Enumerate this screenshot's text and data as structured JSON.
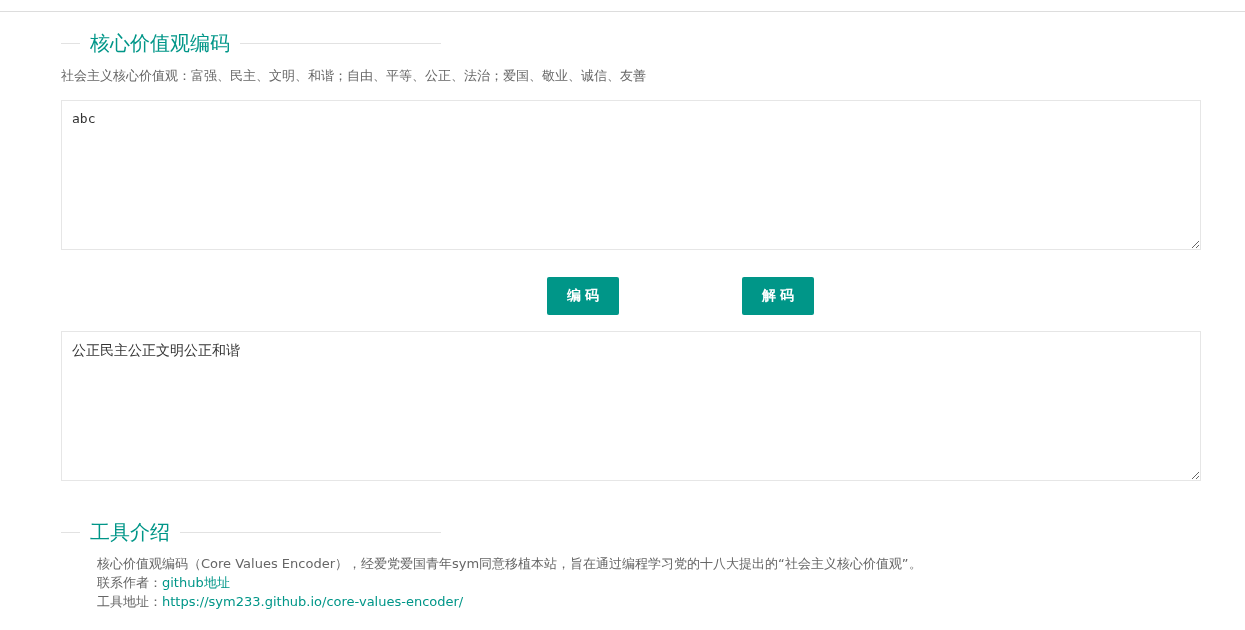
{
  "encoder": {
    "title": "核心价值观编码",
    "subtitle": "社会主义核心价值观：富强、民主、文明、和谐；自由、平等、公正、法治；爱国、敬业、诚信、友善",
    "input": {
      "value": "abc"
    },
    "buttons": [
      "编 码",
      "解 码"
    ],
    "output": {
      "value": "公正民主公正文明公正和谐"
    }
  },
  "intro": {
    "title": "工具介绍",
    "description": "核心价值观编码（Core Values Encoder），经爱党爱国青年sym同意移植本站，旨在通过编程学习党的十八大提出的“社会主义核心价值观”。",
    "lines": [
      {
        "label": "联系作者：",
        "link": "github地址"
      },
      {
        "label": "工具地址：",
        "link": "https://sym233.github.io/core-values-encoder/"
      }
    ]
  }
}
